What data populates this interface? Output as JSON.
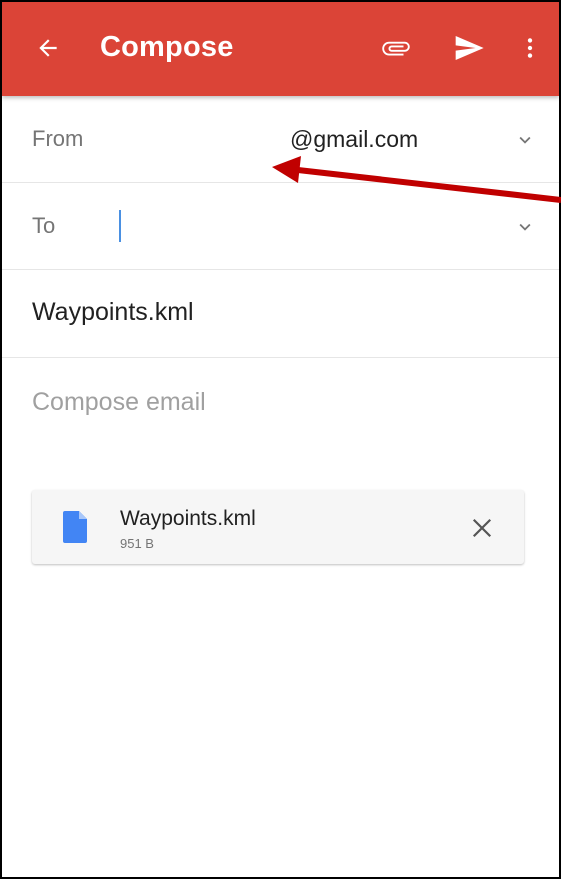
{
  "appbar": {
    "title": "Compose",
    "background_color": "#db4437",
    "icons": [
      "arrow-back-icon",
      "paperclip-icon",
      "send-icon",
      "more-vert-icon"
    ]
  },
  "from": {
    "label": "From",
    "value": "@gmail.com"
  },
  "to": {
    "label": "To",
    "value": ""
  },
  "subject": {
    "value": "Waypoints.kml"
  },
  "body": {
    "placeholder": "Compose email"
  },
  "attachment": {
    "name": "Waypoints.kml",
    "size": "951 B",
    "icon": "file-icon",
    "icon_color": "#4285f4"
  },
  "annotation": {
    "arrow_color": "#c00000"
  }
}
